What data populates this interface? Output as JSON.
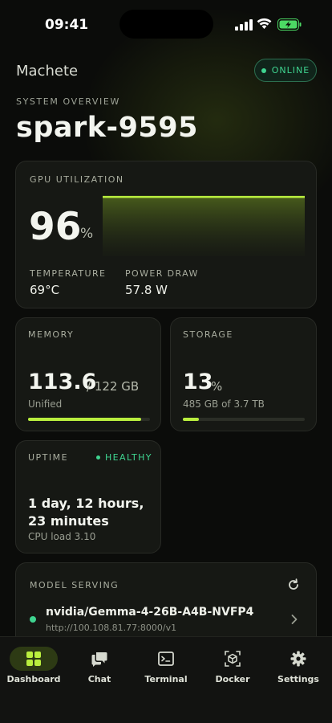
{
  "status": {
    "time": "09:41"
  },
  "header": {
    "brand": "Machete",
    "status_pill": "ONLINE",
    "overline": "SYSTEM OVERVIEW",
    "hostname": "spark-9595"
  },
  "gpu": {
    "label": "GPU UTILIZATION",
    "value": "96",
    "unit": "%",
    "utilization_fraction": 0.96,
    "temperature_label": "TEMPERATURE",
    "temperature": "69°C",
    "power_label": "POWER DRAW",
    "power": "57.8 W"
  },
  "memory": {
    "label": "MEMORY",
    "used": "113.6",
    "total": "/ 122 GB",
    "detail": "Unified",
    "fill_fraction": 0.93
  },
  "storage": {
    "label": "STORAGE",
    "value": "13",
    "unit": "%",
    "detail": "485 GB of 3.7 TB",
    "fill_fraction": 0.13
  },
  "uptime": {
    "label": "UPTIME",
    "health": "HEALTHY",
    "value": "1 day, 12 hours, 23 minutes",
    "cpu": "CPU load 3.10"
  },
  "model_serving": {
    "label": "MODEL SERVING",
    "model": "nvidia/Gemma-4-26B-A4B-NVFP4",
    "url": "http://100.108.81.77:8000/v1"
  },
  "tabs": [
    {
      "label": "Dashboard",
      "icon": "dashboard-icon"
    },
    {
      "label": "Chat",
      "icon": "chat-icon"
    },
    {
      "label": "Terminal",
      "icon": "terminal-icon"
    },
    {
      "label": "Docker",
      "icon": "docker-icon"
    },
    {
      "label": "Settings",
      "icon": "gear-icon"
    }
  ],
  "colors": {
    "accent": "#b9ee3e",
    "status_green": "#3fd490",
    "background": "#0b0c0a",
    "card": "#161814"
  }
}
